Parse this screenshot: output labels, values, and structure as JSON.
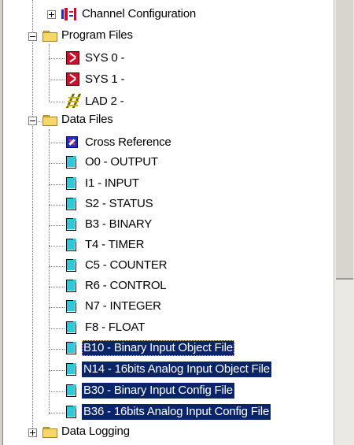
{
  "tree": {
    "channel_configuration": "Channel Configuration",
    "program_files": {
      "label": "Program Files",
      "children": [
        "SYS 0 -",
        "SYS 1 -",
        "LAD 2 -"
      ]
    },
    "data_files": {
      "label": "Data Files",
      "children": [
        "Cross Reference",
        "O0 - OUTPUT",
        "I1 - INPUT",
        "S2 - STATUS",
        "B3 - BINARY",
        "T4 - TIMER",
        "C5 - COUNTER",
        "R6 - CONTROL",
        "N7 - INTEGER",
        "F8 - FLOAT",
        "B10 - Binary Input Object File",
        "N14 - 16bits Analog Input Object File",
        "B30 - Binary Input Config File",
        "B36 - 16bits Analog Input Config File"
      ]
    },
    "data_logging": "Data Logging"
  },
  "selection_color": "#0a246a"
}
